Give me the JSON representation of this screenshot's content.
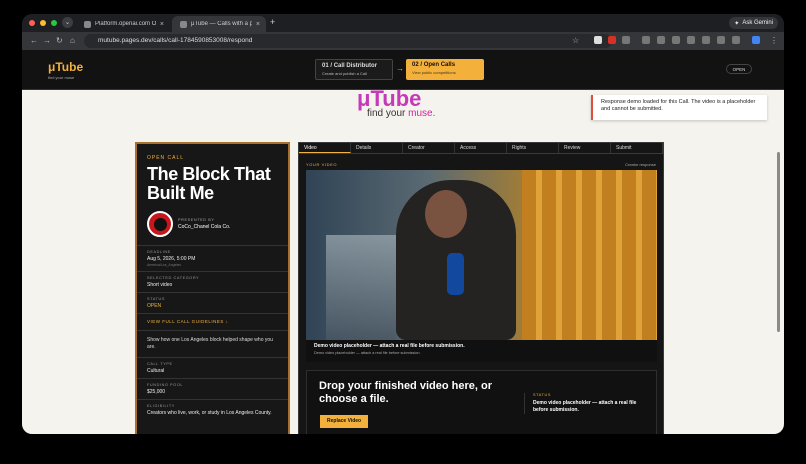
{
  "browser": {
    "tabs": [
      {
        "title": "Platform.openai.com Overvie",
        "active": false
      },
      {
        "title": "μTube — Calls with a public a",
        "active": true
      }
    ],
    "new_tab": "+",
    "ask_gemini": "Ask Gemini",
    "url": "mutube.pages.dev/calls/call-1784590853008/respond"
  },
  "site": {
    "logo": "μTube",
    "logo_sub": "find your muse",
    "steps": [
      {
        "num": "01 /",
        "title": "Call Distributor",
        "subtitle": "Create and publish a Call"
      },
      {
        "num": "02 /",
        "title": "Open Calls",
        "subtitle": "View public competitions"
      }
    ],
    "open_pill": "OPEN",
    "brand": "μTube",
    "tagline_prefix": "find your ",
    "tagline_accent": "muse.",
    "toast": "Response demo loaded for this Call. The video is a placeholder and cannot be submitted."
  },
  "call": {
    "kicker": "OPEN CALL",
    "title": "The Block That Built Me",
    "presented_by": "PRESENTED BY",
    "presenter": "CoCo_Chanel Cola Co.",
    "deadline_label": "DEADLINE",
    "deadline": "Aug 5, 2026, 5:00 PM",
    "timezone": "America/Los_Angeles",
    "category_label": "SELECTED CATEGORY",
    "category": "Short video",
    "status_label": "STATUS",
    "status": "OPEN",
    "guidelines": "VIEW FULL CALL GUIDELINES ↓",
    "description": "Show how one Los Angeles block helped shape who you are.",
    "type_label": "CALL TYPE",
    "type": "Cultural",
    "pool_label": "FUNDING POOL",
    "pool": "$25,000",
    "eligibility_label": "ELIGIBILITY",
    "eligibility": "Creators who live, work, or study in Los Angeles County."
  },
  "response": {
    "tabs": [
      "Video",
      "Details",
      "Creator",
      "Access",
      "Rights",
      "Review",
      "Submit"
    ],
    "video_label": "YOUR VIDEO",
    "creator_response": "Creator response",
    "caption_title": "Demo video placeholder — attach a real file before submission.",
    "caption_sub": "Demo video placeholder — attach a real file before submission.",
    "drop_title": "Drop your finished video here, or choose a file.",
    "replace_button": "Replace Video",
    "status_label": "STATUS",
    "status_text": "Demo video placeholder — attach a real file before submission."
  },
  "colors": {
    "accent": "#f3b13b",
    "brand": "#c026b3",
    "dark": "#151515"
  }
}
